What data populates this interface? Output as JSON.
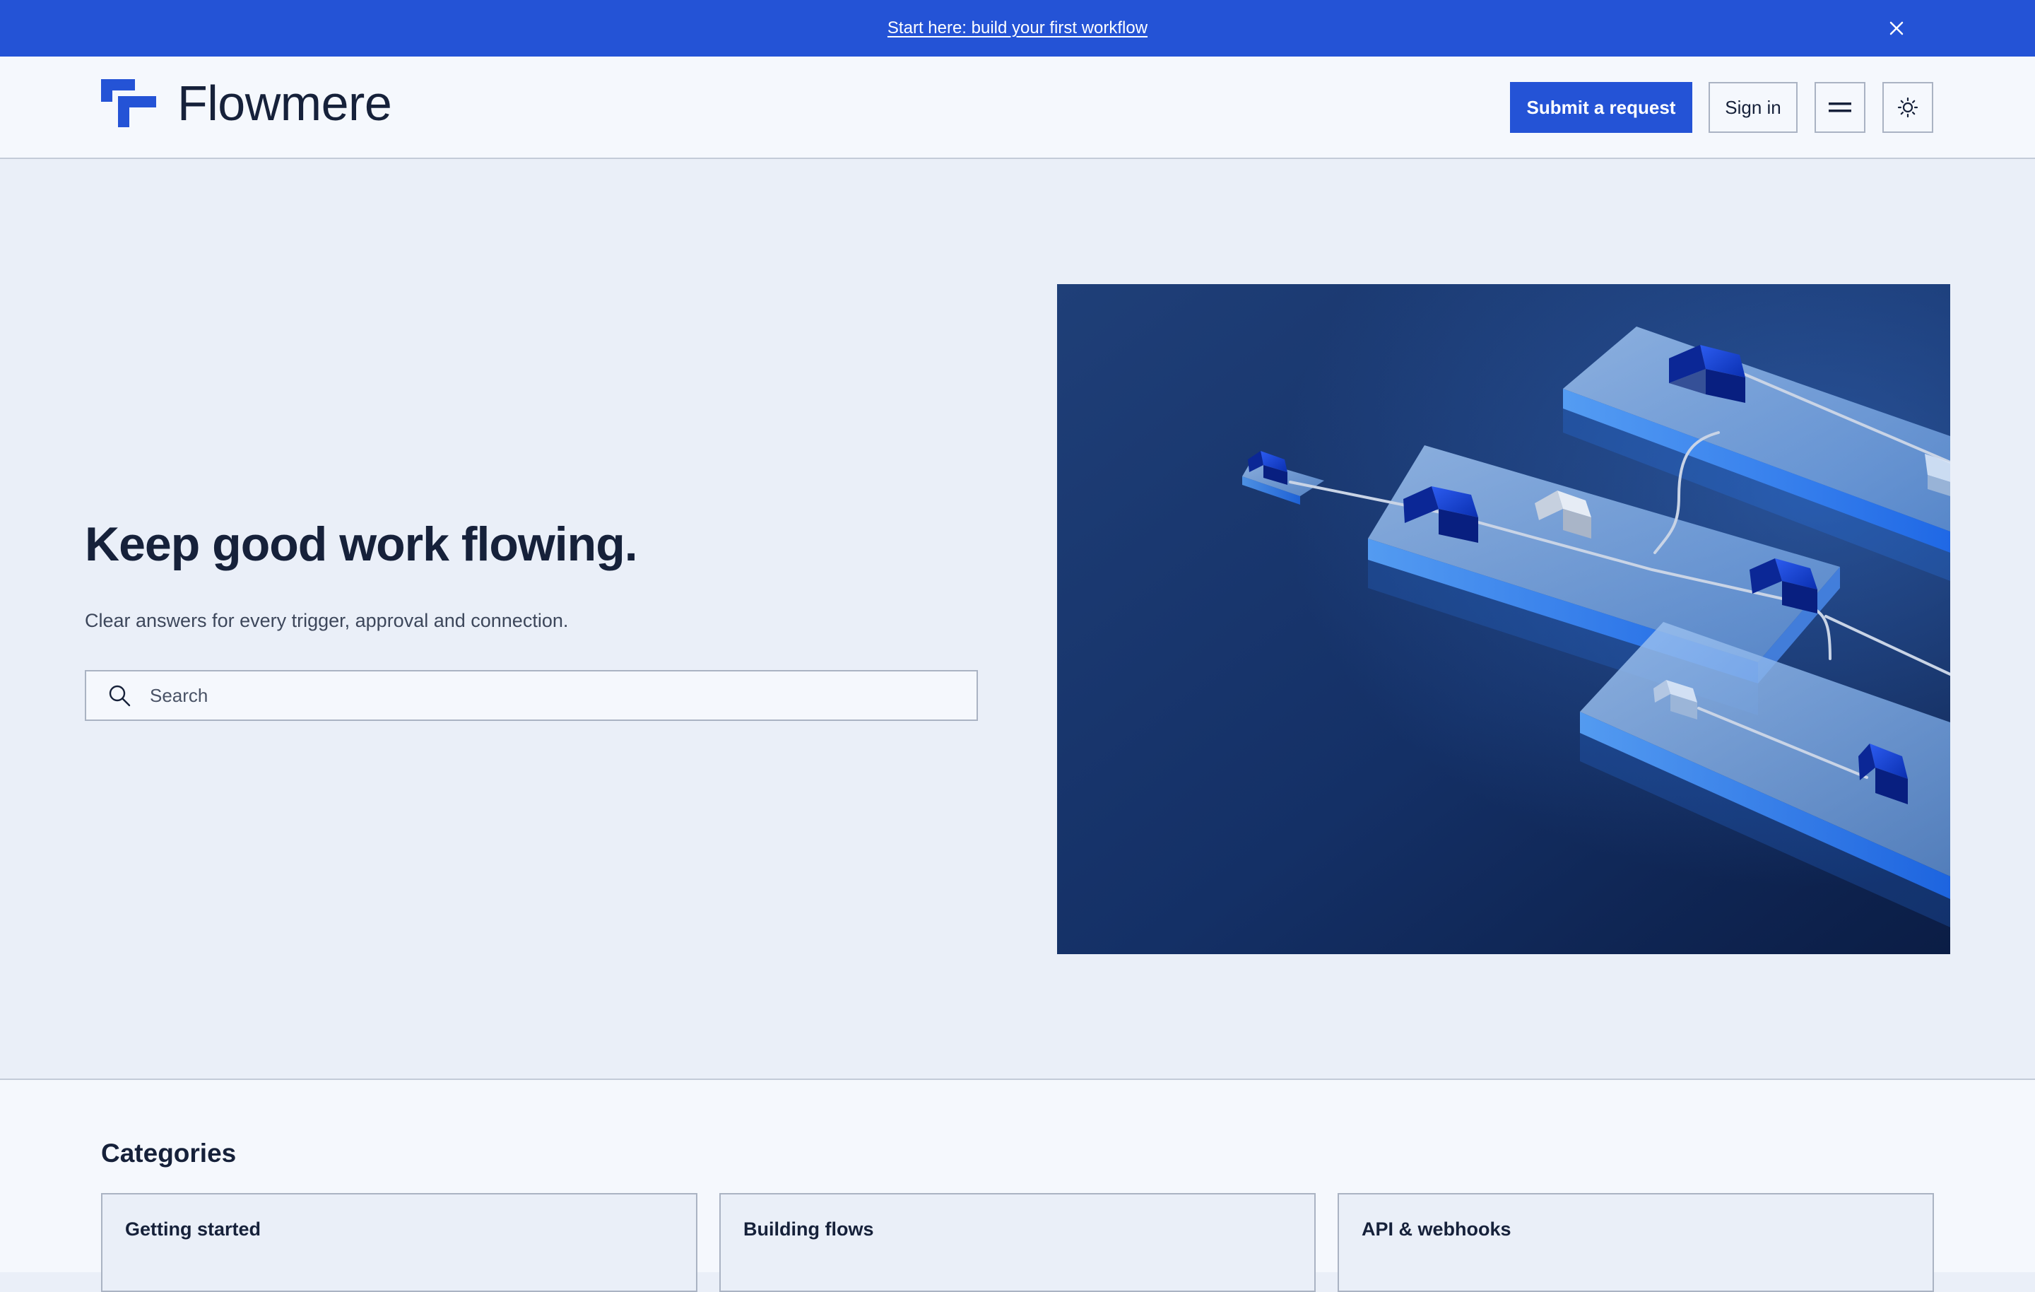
{
  "announcement": {
    "link_text": "Start here: build your first workflow",
    "close_icon": "close-icon"
  },
  "header": {
    "brand": "Flowmere",
    "logo_icon": "flowmere-logo-icon",
    "submit_label": "Submit a request",
    "signin_label": "Sign in",
    "menu_icon": "menu-icon",
    "theme_icon": "sun-icon"
  },
  "hero": {
    "title": "Keep good work flowing.",
    "subtitle": "Clear answers for every trigger, approval and connection.",
    "search_placeholder": "Search",
    "search_icon": "search-icon",
    "image": "hero-illustration"
  },
  "categories": {
    "heading": "Categories",
    "items": [
      {
        "title": "Getting started"
      },
      {
        "title": "Building flows"
      },
      {
        "title": "API & webhooks"
      }
    ]
  },
  "colors": {
    "accent": "#2453d6",
    "page_bg": "#eaeff8",
    "header_bg": "#f5f8fd",
    "text": "#16213a",
    "border": "#aab3c3"
  }
}
